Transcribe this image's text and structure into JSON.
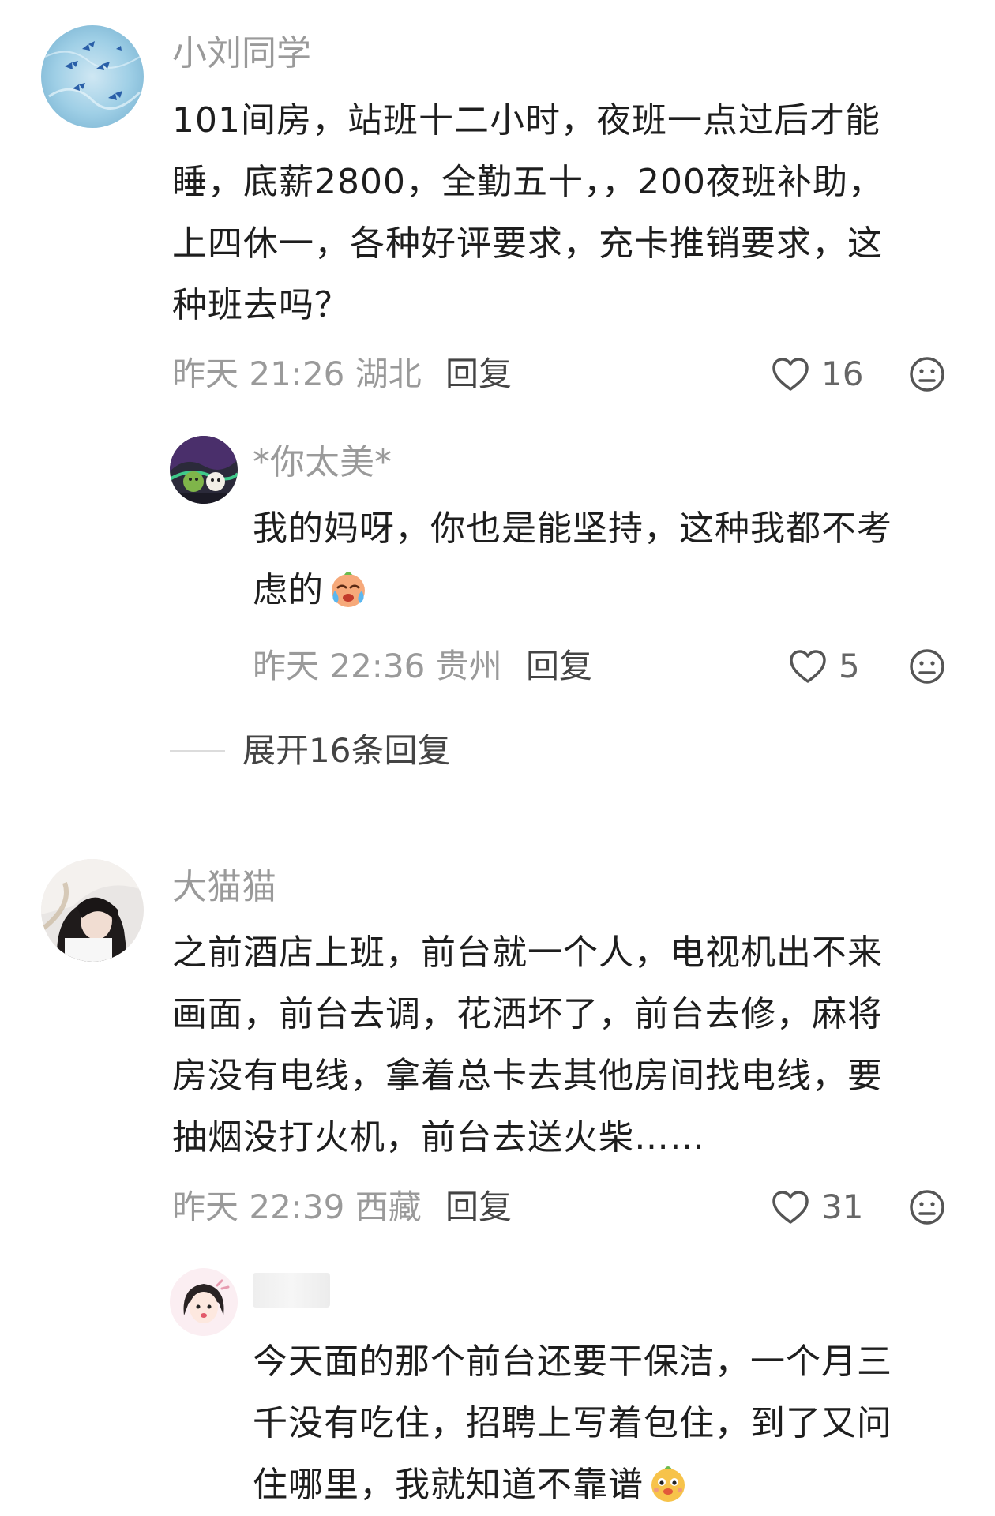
{
  "comments": [
    {
      "username": "小刘同学",
      "lines": [
        "101间房，站班十二小时，夜班一点过后才能",
        "睡，底薪2800，全勤五十，，200夜班补助，",
        "上四休一，各种好评要求，充卡推销要求，这",
        "种班去吗？"
      ],
      "time": "昨天 21:26 湖北",
      "reply_label": "回复",
      "likes": "16",
      "replies": [
        {
          "username": "*你太美*",
          "lines": [
            "我的妈呀，你也是能坚持，这种我都不考",
            "虑的"
          ],
          "emoji": "crying-face-emoji",
          "time": "昨天 22:36 贵州",
          "reply_label": "回复",
          "likes": "5"
        }
      ],
      "expand_label": "展开16条回复"
    },
    {
      "username": "大猫猫",
      "lines": [
        "之前酒店上班，前台就一个人，电视机出不来",
        "画面，前台去调，花洒坏了，前台去修，麻将",
        "房没有电线，拿着总卡去其他房间找电线，要",
        "抽烟没打火机，前台去送火柴……"
      ],
      "time": "昨天 22:39 西藏",
      "reply_label": "回复",
      "likes": "31",
      "replies": [
        {
          "username": "",
          "lines": [
            "今天面的那个前台还要干保洁，一个月三",
            "千没有吃住，招聘上写着包住，到了又问",
            "住哪里，我就知道不靠谱"
          ],
          "emoji": "dog-face-emoji"
        }
      ]
    }
  ],
  "icons": {
    "like": "heart-outline-icon",
    "dislike": "meh-face-icon"
  },
  "colors": {
    "text": "#1e1e1e",
    "muted": "#9a9a9a",
    "action": "#444444"
  }
}
